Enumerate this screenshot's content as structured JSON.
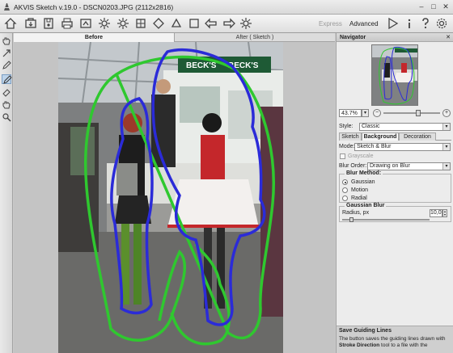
{
  "window": {
    "title": "AKVIS Sketch v.19.0 - DSCN0203.JPG (2112x2816)",
    "minimize": "–",
    "maximize": "□",
    "close": "✕"
  },
  "toolbar": {
    "icons": [
      "home-icon",
      "open-icon",
      "save-icon",
      "print-icon",
      "share-icon",
      "batch-icon",
      "gallery-icon",
      "plugin-icon",
      "plugin-icon",
      "plugin-icon",
      "undo-icon",
      "redo-icon",
      "settings-icon"
    ],
    "mode_express": "Express",
    "mode_advanced": "Advanced",
    "right_icons": [
      "run-icon",
      "info-icon",
      "help-icon",
      "preferences-icon"
    ]
  },
  "left_tools": [
    "hand-icon",
    "direction-icon",
    "pencil-icon",
    "pencil-active-icon",
    "eraser-icon",
    "hand-icon",
    "zoom-icon"
  ],
  "view_tabs": {
    "before": "Before",
    "after": "After ( Sketch )"
  },
  "navigator": {
    "title": "Navigator",
    "close": "✕",
    "zoom": "43.7%",
    "zoom_level": 0.62,
    "minus": "−",
    "plus": "+"
  },
  "settings": {
    "style_label": "Style:",
    "style_value": "Classic",
    "tabs": [
      "Sketch",
      "Background",
      "Decoration"
    ],
    "active_tab": "Background",
    "mode_label": "Mode:",
    "mode_value": "Sketch & Blur",
    "grayscale_label": "Grayscale",
    "grayscale_checked": false,
    "blur_order_label": "Blur Order:",
    "blur_order_value": "Drawing on Blur",
    "blur_method": {
      "title": "Blur Method:",
      "options": [
        "Gaussian",
        "Motion",
        "Radial"
      ],
      "selected": "Gaussian"
    },
    "gaussian_blur": {
      "title": "Gaussian Blur",
      "radius_label": "Radius, px",
      "radius_value": "10,0",
      "radius_level": 0.1
    }
  },
  "help": {
    "title": "Save Guiding Lines",
    "text_before": "The button saves the guiding lines drawn with",
    "text_bold": "Stroke Direction",
    "text_after": "tool to a file with the"
  },
  "photo_signs": {
    "left_sign": "BECK'S",
    "right_sign": "BECK'S"
  }
}
